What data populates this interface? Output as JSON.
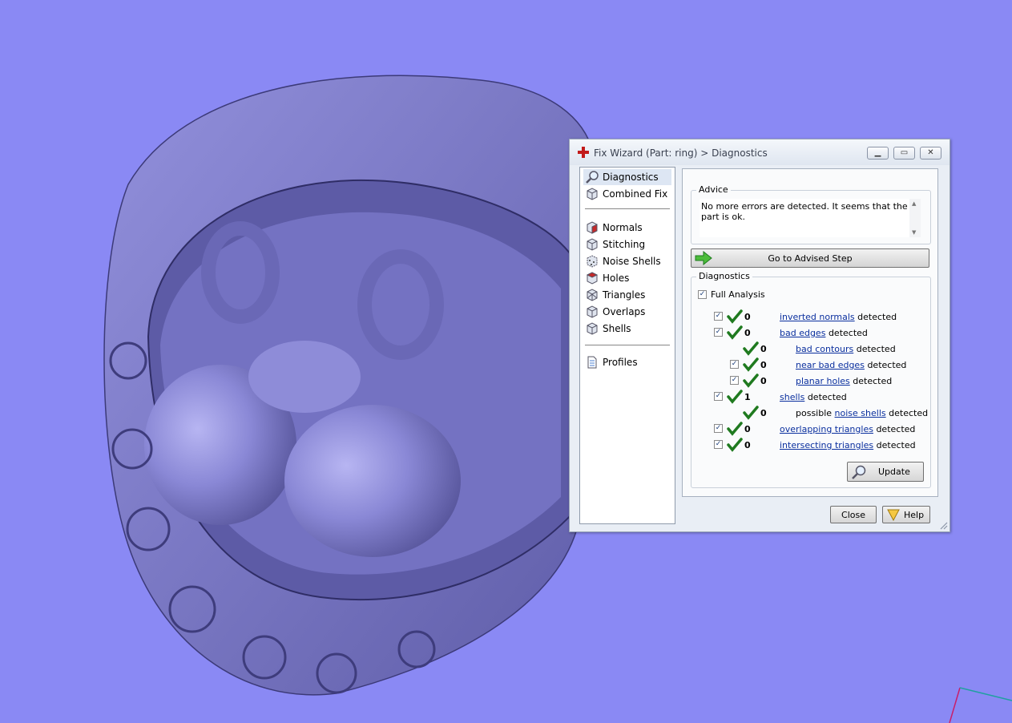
{
  "colors": {
    "viewport_bg": "#8a89f4",
    "model": "#7674c4",
    "check": "#1f7a1f",
    "link": "#0a2f9e"
  },
  "dialog": {
    "title": "Fix Wizard (Part: ring) > Diagnostics",
    "window_buttons": [
      "minimize-icon",
      "restore-icon",
      "close-icon"
    ]
  },
  "nav": {
    "items": [
      {
        "label": "Diagnostics",
        "icon": "magnifier-icon",
        "selected": true
      },
      {
        "label": "Combined Fix",
        "icon": "cube-icon"
      },
      {
        "label": "Normals",
        "icon": "cube-red-face-icon"
      },
      {
        "label": "Stitching",
        "icon": "cube-icon"
      },
      {
        "label": "Noise Shells",
        "icon": "dotted-cube-icon"
      },
      {
        "label": "Holes",
        "icon": "cube-hole-icon"
      },
      {
        "label": "Triangles",
        "icon": "cube-triangles-icon"
      },
      {
        "label": "Overlaps",
        "icon": "cube-icon"
      },
      {
        "label": "Shells",
        "icon": "cube-icon"
      },
      {
        "label": "Profiles",
        "icon": "document-icon"
      }
    ]
  },
  "advice": {
    "title": "Advice",
    "text": "No more errors are detected. It seems that the part is ok."
  },
  "advised_step_label": "Go to Advised Step",
  "diagnostics": {
    "title": "Diagnostics",
    "full_analysis_label": "Full Analysis",
    "rows": [
      {
        "checked": true,
        "count": "0",
        "prefix": "",
        "link": "inverted normals",
        "suffix": "detected"
      },
      {
        "checked": true,
        "count": "0",
        "prefix": "",
        "link": "bad edges",
        "suffix": "detected"
      },
      {
        "checked": false,
        "count": "0",
        "prefix": "",
        "link": "bad contours",
        "suffix": "detected"
      },
      {
        "checked": true,
        "count": "0",
        "prefix": "",
        "link": "near bad edges",
        "suffix": "detected"
      },
      {
        "checked": true,
        "count": "0",
        "prefix": "",
        "link": "planar holes",
        "suffix": "detected"
      },
      {
        "checked": true,
        "count": "1",
        "prefix": "",
        "link": "shells",
        "suffix": "detected"
      },
      {
        "checked": false,
        "count": "0",
        "prefix": "possible",
        "link": "noise shells",
        "suffix": "detected"
      },
      {
        "checked": true,
        "count": "0",
        "prefix": "",
        "link": "overlapping triangles",
        "suffix": "detected"
      },
      {
        "checked": true,
        "count": "0",
        "prefix": "",
        "link": "intersecting triangles",
        "suffix": "detected"
      }
    ],
    "update_label": "Update"
  },
  "footer": {
    "close_label": "Close",
    "help_label": "Help"
  }
}
